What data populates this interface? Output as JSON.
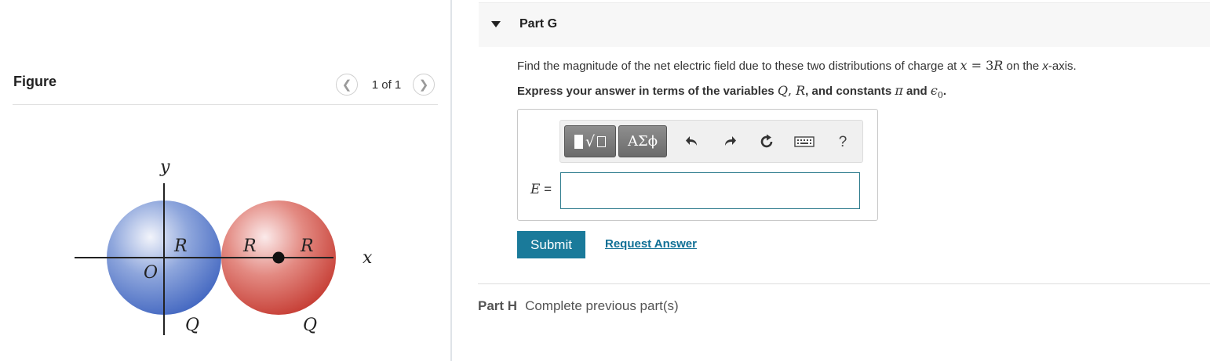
{
  "figure": {
    "title": "Figure",
    "pager": "1 of 1",
    "prev_icon": "chevron-left-icon",
    "next_icon": "chevron-right-icon",
    "labels": {
      "y": "y",
      "x": "x",
      "origin": "O",
      "R1": "R",
      "R2": "R",
      "R3": "R",
      "Q1": "Q",
      "Q2": "Q"
    },
    "colors": {
      "blue_sphere": "#4a6fc4",
      "red_sphere": "#c9423d"
    }
  },
  "part": {
    "title": "Part G",
    "question_prefix": "Find the magnitude of the net electric field due to these two distributions of charge at ",
    "question_math_x": "x",
    "question_math_eq": " = 3",
    "question_math_R": "R",
    "question_suffix": " on the ",
    "question_axis": "x",
    "question_end": "-axis.",
    "instruction_prefix": "Express your answer in terms of the variables ",
    "instruction_Q": "Q",
    "instruction_comma": ", ",
    "instruction_R": "R",
    "instruction_mid": ", and constants ",
    "instruction_pi": "π",
    "instruction_and": " and ",
    "instruction_eps": "ϵ",
    "instruction_eps_sub": "0",
    "instruction_end": "."
  },
  "toolbar": {
    "greek_label": "ΑΣϕ",
    "help_label": "?",
    "icons": [
      "templates-icon",
      "undo-icon",
      "redo-icon",
      "reset-icon",
      "keyboard-icon"
    ]
  },
  "answer": {
    "var_label": "E",
    "equals": " =",
    "value": ""
  },
  "actions": {
    "submit_label": "Submit",
    "request_answer_label": "Request Answer"
  },
  "next_part": {
    "label": "Part H",
    "status": "Complete previous part(s)"
  },
  "colors": {
    "accent": "#1a7a9a",
    "link": "#0f6f95"
  }
}
